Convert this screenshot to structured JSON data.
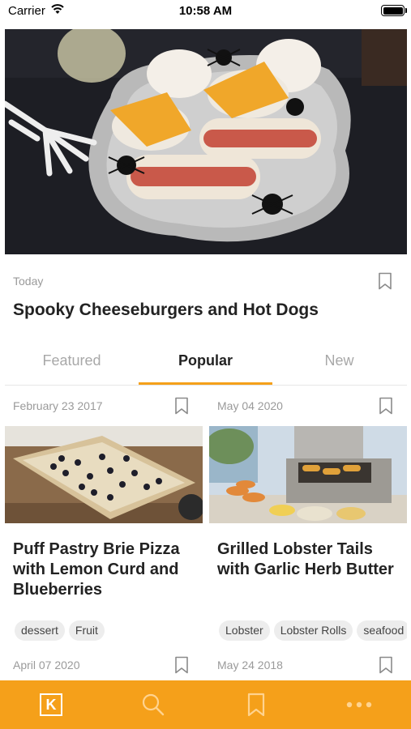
{
  "status": {
    "carrier": "Carrier",
    "time": "10:58 AM"
  },
  "hero": {
    "date": "Today",
    "title": "Spooky Cheeseburgers and Hot Dogs",
    "image_icon": "halloween-burgers-photo"
  },
  "tabs": [
    {
      "label": "Featured",
      "active": false
    },
    {
      "label": "Popular",
      "active": true
    },
    {
      "label": "New",
      "active": false
    }
  ],
  "cards": [
    {
      "date": "February 23 2017",
      "title": "Puff Pastry Brie Pizza with Lemon Curd and Blueberries",
      "tags": [
        "dessert",
        "Fruit"
      ],
      "image_icon": "blueberry-pizza-photo"
    },
    {
      "date": "May 04 2020",
      "title": "Grilled Lobster Tails with Garlic Herb Butter",
      "tags": [
        "Lobster",
        "Lobster Rolls",
        "seafood"
      ],
      "image_icon": "lobster-grill-photo"
    }
  ],
  "next_cards": [
    {
      "date": "April 07 2020"
    },
    {
      "date": "May 24 2018"
    }
  ],
  "tab_bar": {
    "logo_letter": "K",
    "items": [
      "home-logo-icon",
      "search-icon",
      "bookmark-icon",
      "more-icon"
    ]
  },
  "colors": {
    "accent": "#f5a01a",
    "muted_text": "#9a9a9a",
    "tag_bg": "#ededed"
  }
}
